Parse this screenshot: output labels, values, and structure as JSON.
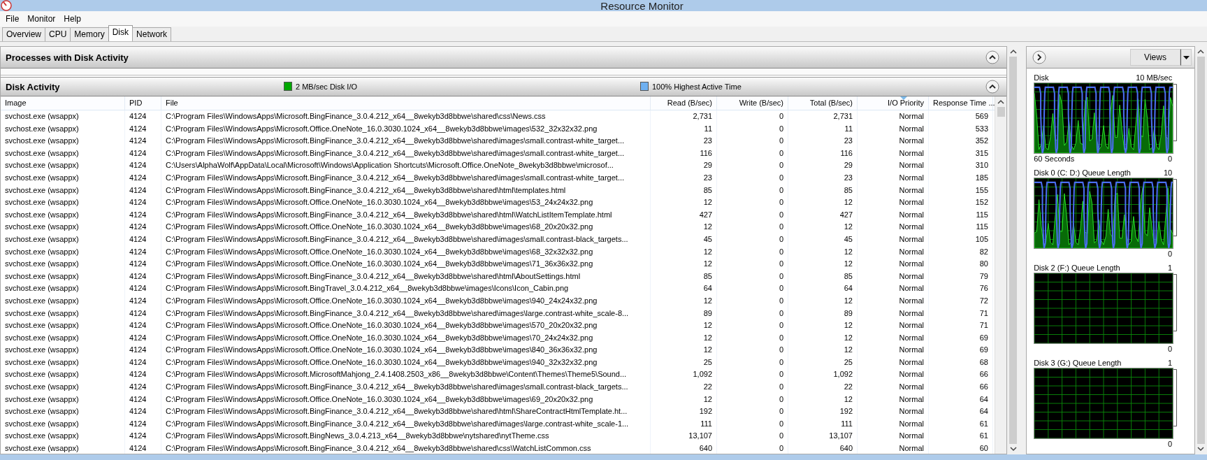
{
  "window": {
    "title": "Resource Monitor"
  },
  "menu": [
    "File",
    "Monitor",
    "Help"
  ],
  "tabs": [
    {
      "label": "Overview",
      "selected": false
    },
    {
      "label": "CPU",
      "selected": false
    },
    {
      "label": "Memory",
      "selected": false
    },
    {
      "label": "Disk",
      "selected": true
    },
    {
      "label": "Network",
      "selected": false
    }
  ],
  "processes_section": {
    "title": "Processes with Disk Activity",
    "expanded": true
  },
  "disk_activity": {
    "title": "Disk Activity",
    "expanded": true,
    "legend": [
      {
        "label": "2 MB/sec Disk I/O",
        "color": "#00a800"
      },
      {
        "label": "100% Highest Active Time",
        "color": "#6fb0f0"
      }
    ],
    "columns": [
      {
        "label": "Image",
        "sorted": false
      },
      {
        "label": "PID",
        "sorted": false
      },
      {
        "label": "File",
        "sorted": false
      },
      {
        "label": "Read (B/sec)",
        "sorted": false
      },
      {
        "label": "Write (B/sec)",
        "sorted": false
      },
      {
        "label": "Total (B/sec)",
        "sorted": false
      },
      {
        "label": "I/O Priority",
        "sorted": true
      },
      {
        "label": "Response Time ...",
        "sorted": false
      }
    ],
    "rows": [
      [
        "svchost.exe (wsappx)",
        "4124",
        "C:\\Program Files\\WindowsApps\\Microsoft.BingFinance_3.0.4.212_x64__8wekyb3d8bbwe\\shared\\css\\News.css",
        "2,731",
        "0",
        "2,731",
        "Normal",
        "569"
      ],
      [
        "svchost.exe (wsappx)",
        "4124",
        "C:\\Program Files\\WindowsApps\\Microsoft.Office.OneNote_16.0.3030.1024_x64__8wekyb3d8bbwe\\images\\532_32x32x32.png",
        "11",
        "0",
        "11",
        "Normal",
        "533"
      ],
      [
        "svchost.exe (wsappx)",
        "4124",
        "C:\\Program Files\\WindowsApps\\Microsoft.BingFinance_3.0.4.212_x64__8wekyb3d8bbwe\\shared\\images\\small.contrast-white_target...",
        "23",
        "0",
        "23",
        "Normal",
        "352"
      ],
      [
        "svchost.exe (wsappx)",
        "4124",
        "C:\\Program Files\\WindowsApps\\Microsoft.BingFinance_3.0.4.212_x64__8wekyb3d8bbwe\\shared\\images\\small.contrast-white_target...",
        "116",
        "0",
        "116",
        "Normal",
        "315"
      ],
      [
        "svchost.exe (wsappx)",
        "4124",
        "C:\\Users\\AlphaWolf\\AppData\\Local\\Microsoft\\Windows\\Application Shortcuts\\Microsoft.Office.OneNote_8wekyb3d8bbwe\\microsof...",
        "29",
        "0",
        "29",
        "Normal",
        "310"
      ],
      [
        "svchost.exe (wsappx)",
        "4124",
        "C:\\Program Files\\WindowsApps\\Microsoft.BingFinance_3.0.4.212_x64__8wekyb3d8bbwe\\shared\\images\\small.contrast-white_target...",
        "23",
        "0",
        "23",
        "Normal",
        "185"
      ],
      [
        "svchost.exe (wsappx)",
        "4124",
        "C:\\Program Files\\WindowsApps\\Microsoft.BingFinance_3.0.4.212_x64__8wekyb3d8bbwe\\shared\\html\\templates.html",
        "85",
        "0",
        "85",
        "Normal",
        "155"
      ],
      [
        "svchost.exe (wsappx)",
        "4124",
        "C:\\Program Files\\WindowsApps\\Microsoft.Office.OneNote_16.0.3030.1024_x64__8wekyb3d8bbwe\\images\\53_24x24x32.png",
        "12",
        "0",
        "12",
        "Normal",
        "152"
      ],
      [
        "svchost.exe (wsappx)",
        "4124",
        "C:\\Program Files\\WindowsApps\\Microsoft.BingFinance_3.0.4.212_x64__8wekyb3d8bbwe\\shared\\html\\WatchListItemTemplate.html",
        "427",
        "0",
        "427",
        "Normal",
        "115"
      ],
      [
        "svchost.exe (wsappx)",
        "4124",
        "C:\\Program Files\\WindowsApps\\Microsoft.Office.OneNote_16.0.3030.1024_x64__8wekyb3d8bbwe\\images\\68_20x20x32.png",
        "12",
        "0",
        "12",
        "Normal",
        "115"
      ],
      [
        "svchost.exe (wsappx)",
        "4124",
        "C:\\Program Files\\WindowsApps\\Microsoft.BingFinance_3.0.4.212_x64__8wekyb3d8bbwe\\shared\\images\\small.contrast-black_targets...",
        "45",
        "0",
        "45",
        "Normal",
        "105"
      ],
      [
        "svchost.exe (wsappx)",
        "4124",
        "C:\\Program Files\\WindowsApps\\Microsoft.Office.OneNote_16.0.3030.1024_x64__8wekyb3d8bbwe\\images\\68_32x32x32.png",
        "12",
        "0",
        "12",
        "Normal",
        "82"
      ],
      [
        "svchost.exe (wsappx)",
        "4124",
        "C:\\Program Files\\WindowsApps\\Microsoft.Office.OneNote_16.0.3030.1024_x64__8wekyb3d8bbwe\\images\\71_36x36x32.png",
        "12",
        "0",
        "12",
        "Normal",
        "80"
      ],
      [
        "svchost.exe (wsappx)",
        "4124",
        "C:\\Program Files\\WindowsApps\\Microsoft.BingFinance_3.0.4.212_x64__8wekyb3d8bbwe\\shared\\html\\AboutSettings.html",
        "85",
        "0",
        "85",
        "Normal",
        "79"
      ],
      [
        "svchost.exe (wsappx)",
        "4124",
        "C:\\Program Files\\WindowsApps\\Microsoft.BingTravel_3.0.4.212_x64__8wekyb3d8bbwe\\images\\Icons\\Icon_Cabin.png",
        "64",
        "0",
        "64",
        "Normal",
        "76"
      ],
      [
        "svchost.exe (wsappx)",
        "4124",
        "C:\\Program Files\\WindowsApps\\Microsoft.Office.OneNote_16.0.3030.1024_x64__8wekyb3d8bbwe\\images\\940_24x24x32.png",
        "12",
        "0",
        "12",
        "Normal",
        "72"
      ],
      [
        "svchost.exe (wsappx)",
        "4124",
        "C:\\Program Files\\WindowsApps\\Microsoft.BingFinance_3.0.4.212_x64__8wekyb3d8bbwe\\shared\\images\\large.contrast-white_scale-8...",
        "89",
        "0",
        "89",
        "Normal",
        "71"
      ],
      [
        "svchost.exe (wsappx)",
        "4124",
        "C:\\Program Files\\WindowsApps\\Microsoft.Office.OneNote_16.0.3030.1024_x64__8wekyb3d8bbwe\\images\\570_20x20x32.png",
        "12",
        "0",
        "12",
        "Normal",
        "71"
      ],
      [
        "svchost.exe (wsappx)",
        "4124",
        "C:\\Program Files\\WindowsApps\\Microsoft.Office.OneNote_16.0.3030.1024_x64__8wekyb3d8bbwe\\images\\70_24x24x32.png",
        "12",
        "0",
        "12",
        "Normal",
        "69"
      ],
      [
        "svchost.exe (wsappx)",
        "4124",
        "C:\\Program Files\\WindowsApps\\Microsoft.Office.OneNote_16.0.3030.1024_x64__8wekyb3d8bbwe\\images\\840_36x36x32.png",
        "12",
        "0",
        "12",
        "Normal",
        "69"
      ],
      [
        "svchost.exe (wsappx)",
        "4124",
        "C:\\Program Files\\WindowsApps\\Microsoft.Office.OneNote_16.0.3030.1024_x64__8wekyb3d8bbwe\\images\\940_32x32x32.png",
        "25",
        "0",
        "25",
        "Normal",
        "68"
      ],
      [
        "svchost.exe (wsappx)",
        "4124",
        "C:\\Program Files\\WindowsApps\\Microsoft.MicrosoftMahjong_2.4.1408.2503_x86__8wekyb3d8bbwe\\Content\\Themes\\Theme5\\Sound...",
        "1,092",
        "0",
        "1,092",
        "Normal",
        "66"
      ],
      [
        "svchost.exe (wsappx)",
        "4124",
        "C:\\Program Files\\WindowsApps\\Microsoft.BingFinance_3.0.4.212_x64__8wekyb3d8bbwe\\shared\\images\\small.contrast-black_targets...",
        "22",
        "0",
        "22",
        "Normal",
        "66"
      ],
      [
        "svchost.exe (wsappx)",
        "4124",
        "C:\\Program Files\\WindowsApps\\Microsoft.Office.OneNote_16.0.3030.1024_x64__8wekyb3d8bbwe\\images\\69_20x20x32.png",
        "12",
        "0",
        "12",
        "Normal",
        "64"
      ],
      [
        "svchost.exe (wsappx)",
        "4124",
        "C:\\Program Files\\WindowsApps\\Microsoft.BingFinance_3.0.4.212_x64__8wekyb3d8bbwe\\shared\\html\\ShareContractHtmlTemplate.ht...",
        "192",
        "0",
        "192",
        "Normal",
        "64"
      ],
      [
        "svchost.exe (wsappx)",
        "4124",
        "C:\\Program Files\\WindowsApps\\Microsoft.BingFinance_3.0.4.212_x64__8wekyb3d8bbwe\\shared\\images\\large.contrast-white_scale-1...",
        "111",
        "0",
        "111",
        "Normal",
        "61"
      ],
      [
        "svchost.exe (wsappx)",
        "4124",
        "C:\\Program Files\\WindowsApps\\Microsoft.BingNews_3.0.4.213_x64__8wekyb3d8bbwe\\nytshared\\nytTheme.css",
        "13,107",
        "0",
        "13,107",
        "Normal",
        "61"
      ],
      [
        "svchost.exe (wsappx)",
        "4124",
        "C:\\Program Files\\WindowsApps\\Microsoft.BingFinance_3.0.4.212_x64__8wekyb3d8bbwe\\shared\\css\\WatchListCommon.css",
        "640",
        "0",
        "640",
        "Normal",
        "60"
      ]
    ]
  },
  "side_panel": {
    "views_button": "Views",
    "graphs": [
      {
        "title": "Disk",
        "max": "10 MB/sec",
        "min": "0",
        "footer": "60 Seconds",
        "kind": "active"
      },
      {
        "title": "Disk 0 (C: D:) Queue Length",
        "max": "10",
        "min": "0",
        "kind": "active"
      },
      {
        "title": "Disk 2 (F:) Queue Length",
        "max": "1",
        "min": "0",
        "kind": "idle"
      },
      {
        "title": "Disk 3 (G:) Queue Length",
        "max": "1",
        "min": "0",
        "kind": "idle"
      }
    ]
  }
}
